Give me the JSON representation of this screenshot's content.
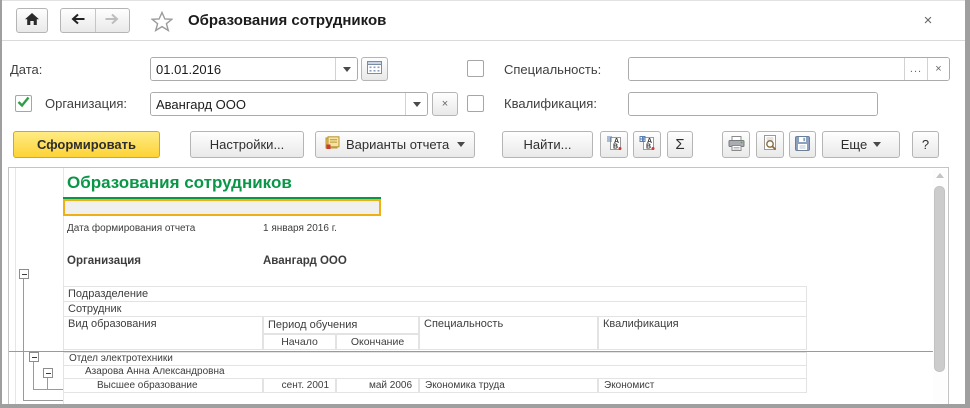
{
  "window": {
    "close": "×"
  },
  "header": {
    "title": "Образования сотрудников"
  },
  "filters": {
    "date_label": "Дата:",
    "date_value": "01.01.2016",
    "org_checked": true,
    "org_label": "Организация:",
    "org_value": "Авангард ООО",
    "org_clear": "×",
    "specialty_label": "Специальность:",
    "specialty_value": "",
    "specialty_ellipsis": "...",
    "specialty_clear": "×",
    "qualification_label": "Квалификация:",
    "qualification_value": ""
  },
  "toolbar": {
    "generate": "Сформировать",
    "settings": "Настройки...",
    "variants": "Варианты отчета",
    "find": "Найти...",
    "sigma": "Σ",
    "more": "Еще",
    "help": "?"
  },
  "report": {
    "title": "Образования сотрудников",
    "generated_label": "Дата формирования отчета",
    "generated_value": "1 января 2016 г.",
    "org_label": "Организация",
    "org_value": "Авангард ООО",
    "subdivision": "Подразделение",
    "employee": "Сотрудник",
    "columns": {
      "education": "Вид образования",
      "period": "Период обучения",
      "start": "Начало",
      "end": "Окончание",
      "specialty": "Специальность",
      "qualification": "Квалификация"
    },
    "groups": {
      "department": "Отдел электротехники",
      "person": "Азарова Анна Александровна"
    },
    "row": {
      "education": "Высшее образование",
      "start": "сент. 2001",
      "end": "май 2006",
      "specialty": "Экономика труда",
      "qualification": "Экономист"
    }
  },
  "colors": {
    "report_title_green": "#0a9648",
    "selection_border": "#eeb012",
    "generate_button_yellow": "#fdd335"
  }
}
